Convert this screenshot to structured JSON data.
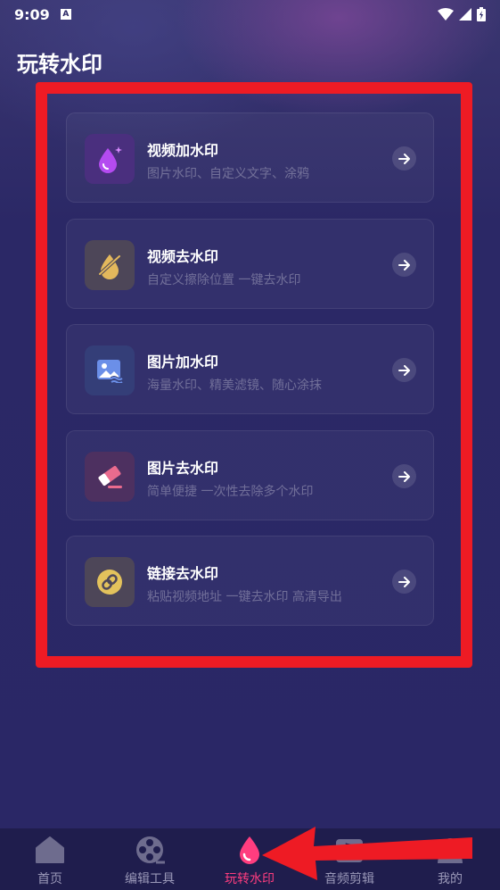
{
  "status_bar": {
    "time": "9:09",
    "notification_badge": "A"
  },
  "page_title": "玩转水印",
  "cards": [
    {
      "title": "视频加水印",
      "desc": "图片水印、自定义文字、涂鸦",
      "icon": "droplet-sparkle-icon",
      "color": "#b44bf0",
      "bg": "#4a2f7e"
    },
    {
      "title": "视频去水印",
      "desc": "自定义擦除位置 一键去水印",
      "icon": "droplet-off-icon",
      "color": "#e3b85c",
      "bg": "#4d4658"
    },
    {
      "title": "图片加水印",
      "desc": "海量水印、精美滤镜、随心涂抹",
      "icon": "image-icon",
      "color": "#6b8fe8",
      "bg": "#343e78"
    },
    {
      "title": "图片去水印",
      "desc": "简单便捷 一次性去除多个水印",
      "icon": "eraser-icon",
      "color": "#ea6b8e",
      "bg": "#4d3060"
    },
    {
      "title": "链接去水印",
      "desc": "粘贴视频地址 一键去水印 高清导出",
      "icon": "link-icon",
      "color": "#e3c25c",
      "bg": "#4d4658"
    }
  ],
  "nav": [
    {
      "label": "首页",
      "icon": "home-icon",
      "active": false
    },
    {
      "label": "编辑工具",
      "icon": "film-reel-icon",
      "active": false
    },
    {
      "label": "玩转水印",
      "icon": "droplet-icon",
      "active": true
    },
    {
      "label": "音频剪辑",
      "icon": "music-icon",
      "active": false
    },
    {
      "label": "我的",
      "icon": "user-icon",
      "active": false
    }
  ],
  "colors": {
    "accent": "#ff3d7f",
    "annotation_red": "#ee1b24",
    "background": "#2a2766"
  }
}
